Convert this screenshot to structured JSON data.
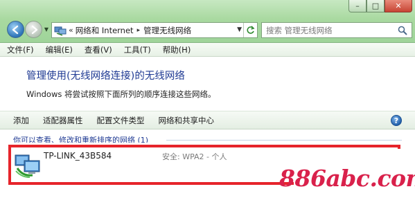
{
  "window": {
    "minimize_symbol": "–",
    "maximize_symbol": "□",
    "close_symbol": "✕"
  },
  "address": {
    "prefix": "«",
    "crumbs": [
      "网络和 Internet",
      "管理无线网络"
    ],
    "crumb_separator": "▸"
  },
  "search": {
    "placeholder": "搜索 管理无线网络"
  },
  "menu": {
    "items": [
      "文件(F)",
      "编辑(E)",
      "查看(V)",
      "工具(T)",
      "帮助(H)"
    ]
  },
  "header": {
    "title": "管理使用(无线网络连接)的无线网络",
    "description": "Windows 将尝试按照下面所列的顺序连接这些网络。"
  },
  "commands": {
    "items": [
      "添加",
      "适配器属性",
      "配置文件类型",
      "网络和共享中心"
    ],
    "help": "?"
  },
  "list": {
    "group_header": "你可以查看、修改和重新排序的网络 (1)",
    "networks": [
      {
        "name": "TP-LINK_43B584",
        "security": "安全: WPA2 - 个人"
      }
    ]
  },
  "watermark": {
    "text": "886abc.com"
  },
  "colors": {
    "highlight_border": "#e6242b",
    "title_blue": "#1f3a93",
    "watermark": "#d9214b"
  }
}
